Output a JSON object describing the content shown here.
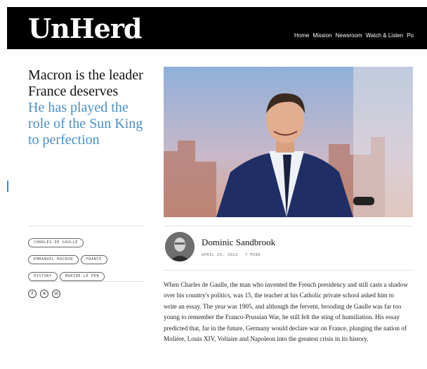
{
  "site": {
    "logo": "UnHerd"
  },
  "nav": [
    "Home",
    "Mission",
    "Newsroom",
    "Watch & Listen",
    "Po"
  ],
  "article": {
    "title": "Macron is the leader France deserves",
    "subtitle": "He has played the role of the Sun King to perfection",
    "author": "Dominic Sandbrook",
    "date": "APRIL 25, 2022",
    "read_time": "7 MINS",
    "body": "When Charles de Gaulle, the man who invented the French presidency and still casts a shadow over his country's politics, was 15, the teacher at his Catholic private school asked him to write an essay. The year was 1905, and although the fervent, brooding de Gaulle was far too young to remember the Franco-Prussian War, he still felt the sting of humiliation. His essay predicted that, far in the future, Germany would declare war on France, plunging the nation of Molière, Louis XIV, Voltaire and Napoleon into the greatest crisis in its history."
  },
  "tags": [
    "CHARLES DE GAULLE",
    "EMMANUEL MACRON",
    "FRANCE",
    "HISTORY",
    "MARINE LE PEN"
  ],
  "share_icons": [
    "facebook-icon",
    "x-icon",
    "email-icon"
  ],
  "colors": {
    "header_bg": "#000000",
    "subtitle": "#4a90c8",
    "accent": "#3b86d6"
  }
}
